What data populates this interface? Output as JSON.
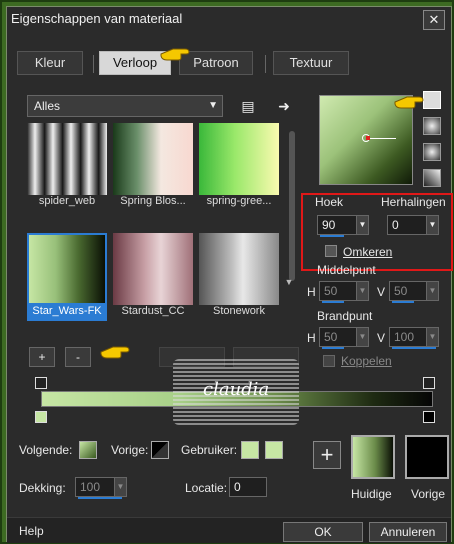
{
  "window": {
    "title": "Eigenschappen van materiaal",
    "close_label": "✕"
  },
  "tabs": [
    {
      "label": "Kleur"
    },
    {
      "label": "Verloop"
    },
    {
      "label": "Patroon"
    },
    {
      "label": "Textuur"
    }
  ],
  "category": {
    "selected": "Alles"
  },
  "gradients": [
    {
      "label": "spider_web"
    },
    {
      "label": "Spring Blos..."
    },
    {
      "label": "spring-gree..."
    },
    {
      "label": "Star_Wars-FK"
    },
    {
      "label": "Stardust_CC"
    },
    {
      "label": "Stonework"
    }
  ],
  "settings": {
    "angle_label": "Hoek",
    "angle_value": "90",
    "repeat_label": "Herhalingen",
    "repeat_value": "0",
    "invert_label": "Omkeren",
    "center_label": "Middelpunt",
    "center_h_label": "H",
    "center_h_value": "50",
    "center_v_label": "V",
    "center_v_value": "50",
    "focus_label": "Brandpunt",
    "focus_h_label": "H",
    "focus_h_value": "50",
    "focus_v_label": "V",
    "focus_v_value": "100",
    "link_label": "Koppelen"
  },
  "list_buttons": {
    "add": "+",
    "remove": "-"
  },
  "bottom": {
    "next_label": "Volgende:",
    "prev_label": "Vorige:",
    "user_label": "Gebruiker:",
    "opacity_label": "Dekking:",
    "opacity_value": "100",
    "location_label": "Locatie:",
    "location_value": "0",
    "add_label": "+",
    "current_label": "Huidige",
    "previous_label": "Vorige"
  },
  "footer": {
    "help": "Help",
    "ok": "OK",
    "cancel": "Annuleren"
  },
  "watermark": {
    "text": "claudia"
  },
  "colors": {
    "accent": "#2b7cd3",
    "highlight_box": "#e01818",
    "light_green": "#c6e6a4",
    "black": "#000000"
  }
}
